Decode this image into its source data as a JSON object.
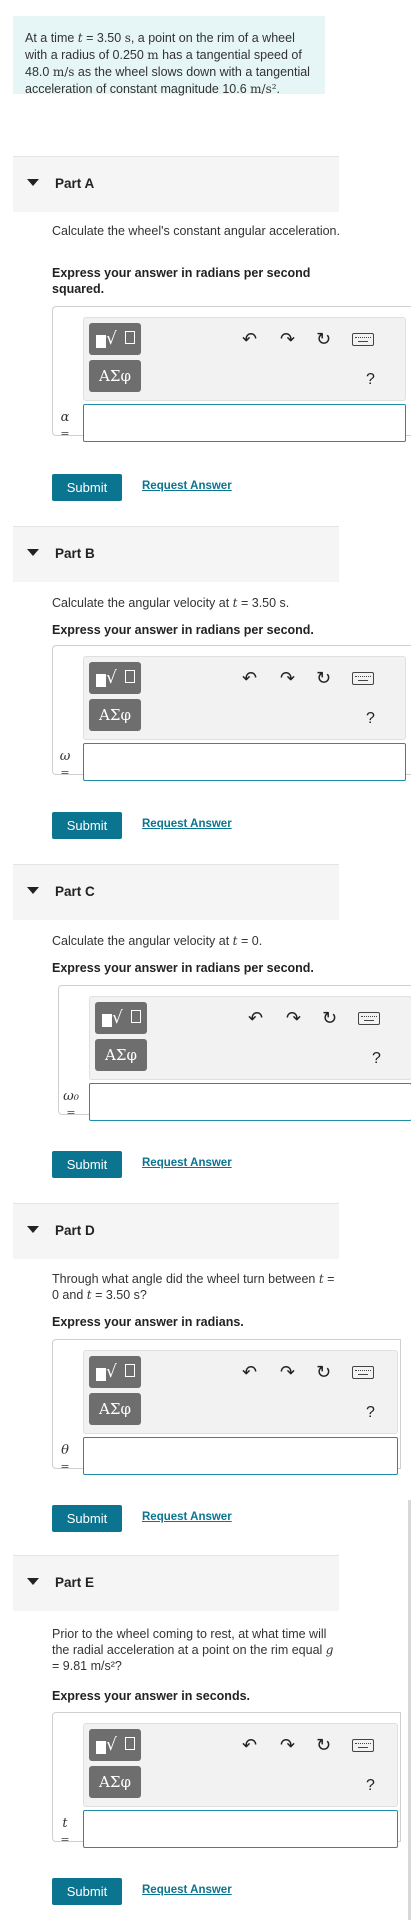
{
  "problem": {
    "t1": "At a time ",
    "t_var": "t",
    "t2": " = 3.50 ",
    "t_unit": "s",
    "t3": ", a point on the rim of a wheel with a radius of 0.250 ",
    "r_unit": "m",
    "t4": " has a tangential speed of 48.0 ",
    "v_unit": "m/s",
    "t5": " as the wheel slows down with a tangential acceleration of constant magnitude 10.6 ",
    "a_unit": "m/s²",
    "t6": "."
  },
  "toolbar": {
    "radical": "√",
    "greek": "ΑΣφ",
    "undo": "↶",
    "redo": "↷",
    "reset": "↻",
    "help": "?"
  },
  "parts": [
    {
      "title": "Part A",
      "question": "Calculate the wheel's constant angular acceleration.",
      "instruction": "Express your answer in radians per second squared.",
      "variable": "α",
      "equals": "=",
      "submit": "Submit",
      "request": "Request Answer"
    },
    {
      "title": "Part B",
      "question_pre": "Calculate the angular velocity at ",
      "question_var": "t",
      "question_post": " = 3.50 s.",
      "instruction": "Express your answer in radians per second.",
      "variable": "ω",
      "equals": "=",
      "submit": "Submit",
      "request": "Request Answer"
    },
    {
      "title": "Part C",
      "question_pre": "Calculate the angular velocity at ",
      "question_var": "t",
      "question_post": " = 0.",
      "instruction": "Express your answer in radians per second.",
      "variable": "ω₀",
      "equals": "=",
      "submit": "Submit",
      "request": "Request Answer"
    },
    {
      "title": "Part D",
      "question_pre": "Through what angle did the wheel turn between ",
      "question_var1": "t",
      "question_mid": " = 0 and ",
      "question_var2": "t",
      "question_post": " = 3.50 s?",
      "instruction": "Express your answer in radians.",
      "variable": "θ",
      "equals": "=",
      "submit": "Submit",
      "request": "Request Answer"
    },
    {
      "title": "Part E",
      "question_pre": "Prior to the wheel coming to rest, at what time will the radial acceleration at a point on the rim equal ",
      "question_var": "g",
      "question_post": " = 9.81 m/s²?",
      "instruction": "Express your answer in seconds.",
      "variable": "t",
      "equals": "=",
      "submit": "Submit",
      "request": "Request Answer"
    }
  ],
  "colors": {
    "accent": "#0b7490",
    "problem_bg": "#e6f5f5",
    "input_border": "#1e8ea8"
  }
}
